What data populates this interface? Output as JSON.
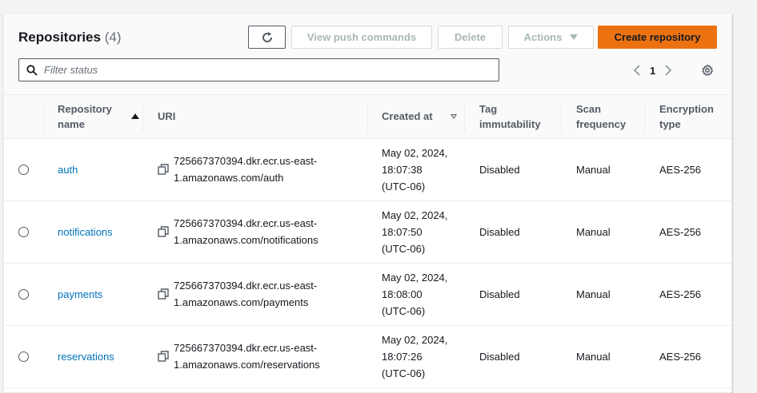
{
  "header": {
    "title": "Repositories",
    "count": "(4)",
    "buttons": {
      "view_push": "View push commands",
      "delete": "Delete",
      "actions": "Actions",
      "create": "Create repository"
    },
    "search_placeholder": "Filter status",
    "current_page": "1"
  },
  "columns": {
    "name": "Repository name",
    "uri": "URI",
    "created": "Created at",
    "tag": "Tag immutability",
    "scan": "Scan frequency",
    "encryption": "Encryption type"
  },
  "rows": [
    {
      "name": "auth",
      "uri_line1": "725667370394.dkr.ecr.us-east-",
      "uri_line2": "1.amazonaws.com/auth",
      "created_date": "May 02, 2024,",
      "created_time": "18:07:38",
      "created_tz": "(UTC-06)",
      "tag": "Disabled",
      "scan": "Manual",
      "encryption": "AES-256"
    },
    {
      "name": "notifications",
      "uri_line1": "725667370394.dkr.ecr.us-east-",
      "uri_line2": "1.amazonaws.com/notifications",
      "created_date": "May 02, 2024,",
      "created_time": "18:07:50",
      "created_tz": "(UTC-06)",
      "tag": "Disabled",
      "scan": "Manual",
      "encryption": "AES-256"
    },
    {
      "name": "payments",
      "uri_line1": "725667370394.dkr.ecr.us-east-",
      "uri_line2": "1.amazonaws.com/payments",
      "created_date": "May 02, 2024,",
      "created_time": "18:08:00",
      "created_tz": "(UTC-06)",
      "tag": "Disabled",
      "scan": "Manual",
      "encryption": "AES-256"
    },
    {
      "name": "reservations",
      "uri_line1": "725667370394.dkr.ecr.us-east-",
      "uri_line2": "1.amazonaws.com/reservations",
      "created_date": "May 02, 2024,",
      "created_time": "18:07:26",
      "created_tz": "(UTC-06)",
      "tag": "Disabled",
      "scan": "Manual",
      "encryption": "AES-256"
    }
  ],
  "icons": {
    "refresh": "refresh-icon",
    "search": "search-icon",
    "prev": "chevron-left-icon",
    "next": "chevron-right-icon",
    "settings": "gear-icon",
    "copy": "copy-icon"
  },
  "colors": {
    "primary": "#ec7211",
    "link": "#0073bb",
    "disabled_text": "#aab7b8"
  }
}
